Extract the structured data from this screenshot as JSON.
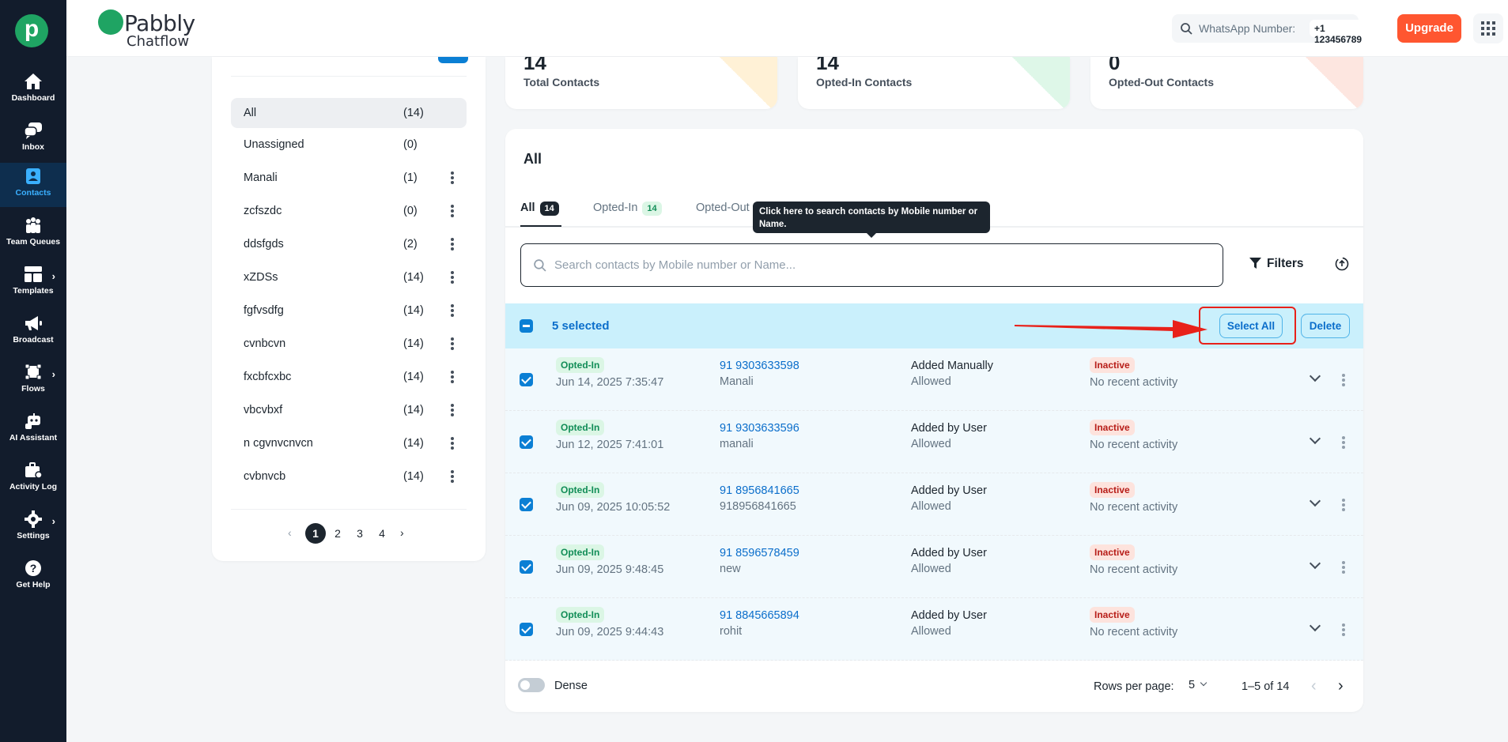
{
  "sidebar": {
    "items": [
      {
        "label": "Dashboard",
        "icon": "home-icon"
      },
      {
        "label": "Inbox",
        "icon": "chat-icon"
      },
      {
        "label": "Contacts",
        "icon": "contact-icon"
      },
      {
        "label": "Team Queues",
        "icon": "team-icon"
      },
      {
        "label": "Templates",
        "icon": "template-icon"
      },
      {
        "label": "Broadcast",
        "icon": "megaphone-icon"
      },
      {
        "label": "Flows",
        "icon": "flow-icon"
      },
      {
        "label": "AI Assistant",
        "icon": "robot-icon"
      },
      {
        "label": "Activity Log",
        "icon": "briefcase-icon"
      },
      {
        "label": "Settings",
        "icon": "gear-icon"
      },
      {
        "label": "Get Help",
        "icon": "help-icon"
      }
    ],
    "active": "Contacts"
  },
  "header": {
    "brand": "Pabbly",
    "brand_sub": "Chatflow",
    "whatsapp_label": "WhatsApp Number:",
    "whatsapp_number": "+1 123456789",
    "upgrade_label": "Upgrade"
  },
  "lists": {
    "items": [
      {
        "name": "All",
        "count": "(14)"
      },
      {
        "name": "Unassigned",
        "count": "(0)"
      },
      {
        "name": "Manali",
        "count": "(1)"
      },
      {
        "name": "zcfszdc",
        "count": "(0)"
      },
      {
        "name": "ddsfgds",
        "count": "(2)"
      },
      {
        "name": "xZDSs",
        "count": "(14)"
      },
      {
        "name": "fgfvsdfg",
        "count": "(14)"
      },
      {
        "name": "cvnbcvn",
        "count": "(14)"
      },
      {
        "name": "fxcbfcxbc",
        "count": "(14)"
      },
      {
        "name": "vbcvbxf",
        "count": "(14)"
      },
      {
        "name": "n cgvnvcnvcn",
        "count": "(14)"
      },
      {
        "name": "cvbnvcb",
        "count": "(14)"
      }
    ],
    "pages": [
      "1",
      "2",
      "3",
      "4"
    ],
    "current_page": "1"
  },
  "stats": [
    {
      "label": "Total Contacts",
      "value": "14",
      "color": "#ffab00"
    },
    {
      "label": "Opted-In Contacts",
      "value": "14",
      "color": "#22c55e"
    },
    {
      "label": "Opted-Out Contacts",
      "value": "0",
      "color": "#ff5630"
    }
  ],
  "table": {
    "title": "All",
    "tabs": [
      {
        "label": "All",
        "count": "14"
      },
      {
        "label": "Opted-In",
        "count": "14"
      },
      {
        "label": "Opted-Out",
        "count": ""
      }
    ],
    "tooltip": "Click here to search contacts by Mobile number or Name.",
    "search_placeholder": "Search contacts by Mobile number or Name...",
    "filters_label": "Filters",
    "selected_text": "5 selected",
    "select_all_label": "Select All",
    "delete_label": "Delete",
    "rows": [
      {
        "status": "Opted-In",
        "date": "Jun 14, 2025 7:35:47",
        "phone": "91 9303633598",
        "name": "Manali",
        "source": "Added Manually",
        "permission": "Allowed",
        "activity_status": "Inactive",
        "activity": "No recent activity"
      },
      {
        "status": "Opted-In",
        "date": "Jun 12, 2025 7:41:01",
        "phone": "91 9303633596",
        "name": "manali",
        "source": "Added by User",
        "permission": "Allowed",
        "activity_status": "Inactive",
        "activity": "No recent activity"
      },
      {
        "status": "Opted-In",
        "date": "Jun 09, 2025 10:05:52",
        "phone": "91 8956841665",
        "name": "918956841665",
        "source": "Added by User",
        "permission": "Allowed",
        "activity_status": "Inactive",
        "activity": "No recent activity"
      },
      {
        "status": "Opted-In",
        "date": "Jun 09, 2025 9:48:45",
        "phone": "91 8596578459",
        "name": "new",
        "source": "Added by User",
        "permission": "Allowed",
        "activity_status": "Inactive",
        "activity": "No recent activity"
      },
      {
        "status": "Opted-In",
        "date": "Jun 09, 2025 9:44:43",
        "phone": "91 8845665894",
        "name": "rohit",
        "source": "Added by User",
        "permission": "Allowed",
        "activity_status": "Inactive",
        "activity": "No recent activity"
      }
    ],
    "dense_label": "Dense",
    "rows_per_page_label": "Rows per page:",
    "rows_per_page": "5",
    "range": "1–5 of 14"
  }
}
